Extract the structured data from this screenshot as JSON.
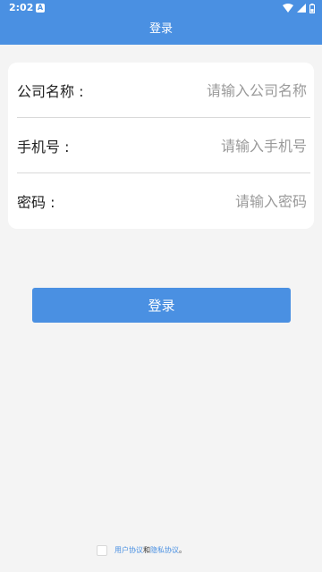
{
  "status_bar": {
    "time": "2:02",
    "notification_glyph": "A",
    "icons": [
      "wifi-icon",
      "signal-icon",
      "battery-icon"
    ]
  },
  "header": {
    "title": "登录"
  },
  "form": {
    "company": {
      "label": "公司名称 :",
      "placeholder": "请输入公司名称"
    },
    "phone": {
      "label": "手机号 :",
      "placeholder": "请输入手机号"
    },
    "password": {
      "label": "密码 :",
      "placeholder": "请输入密码"
    }
  },
  "login_button": {
    "label": "登录"
  },
  "agreement": {
    "user_agreement": "用户协议",
    "and": "和",
    "privacy_policy": "隐私协议",
    "end": "。"
  },
  "colors": {
    "primary": "#4a90e2",
    "background": "#f4f4f4"
  }
}
